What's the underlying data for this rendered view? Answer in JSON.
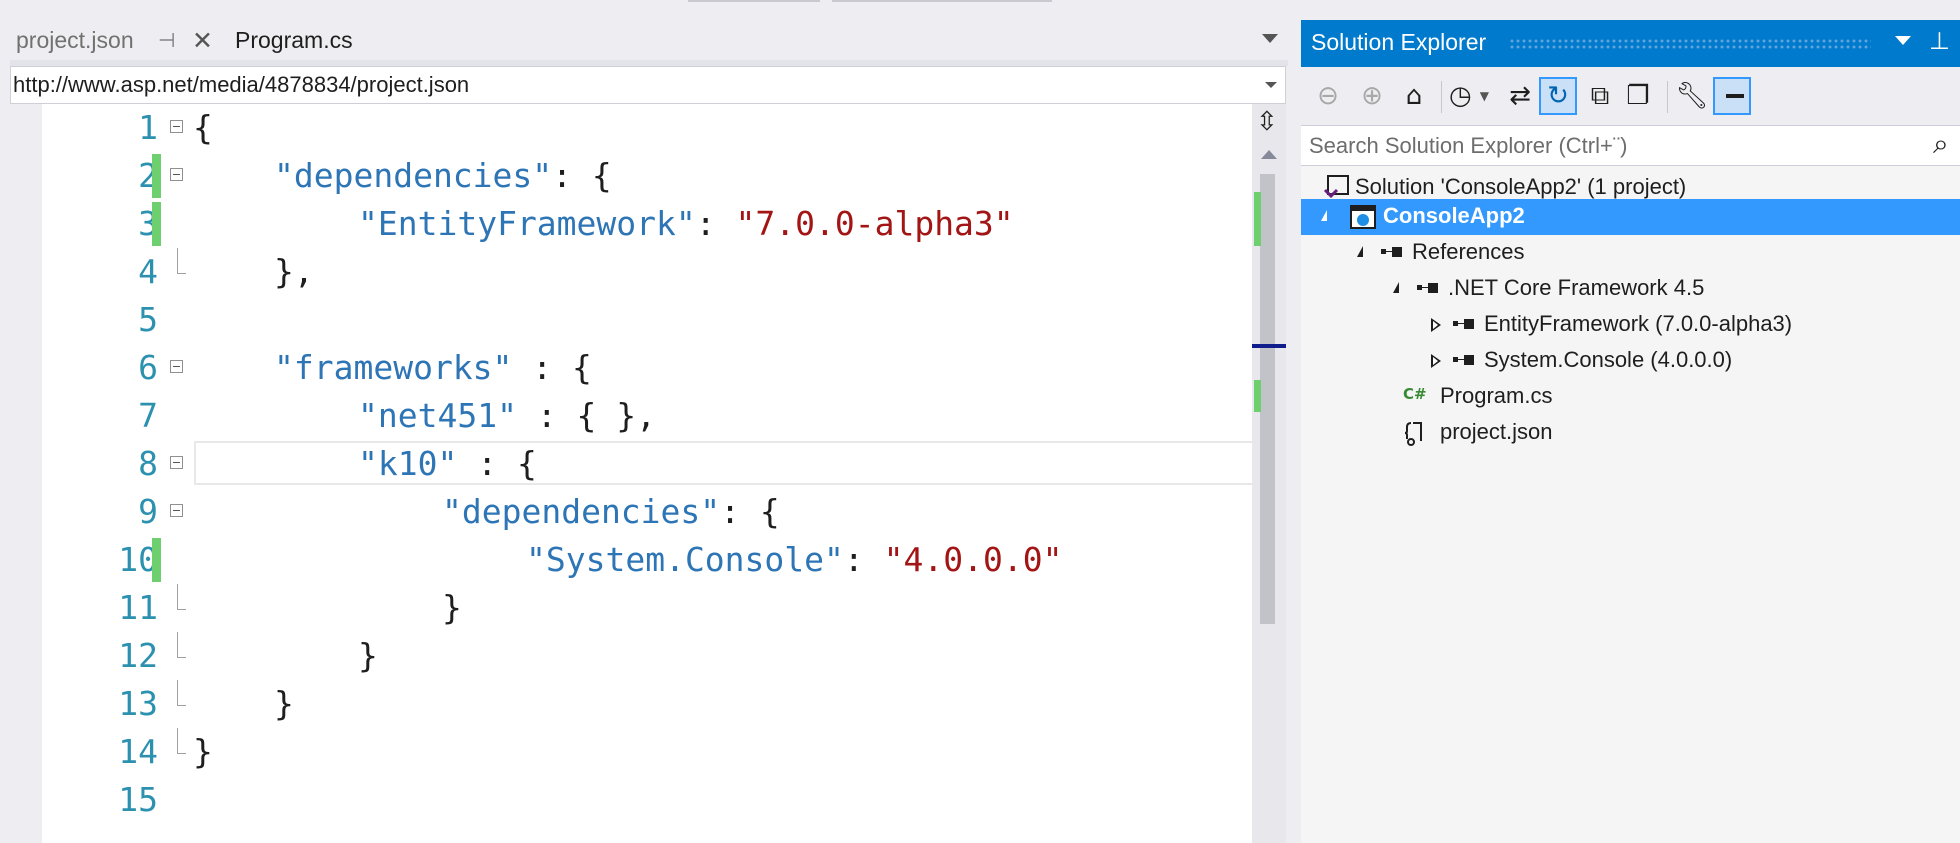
{
  "editor": {
    "tabs": [
      {
        "label": "project.json"
      },
      {
        "label": "Program.cs"
      }
    ],
    "url": "http://www.asp.net/media/4878834/project.json",
    "lines": [
      {
        "num": "1"
      },
      {
        "num": "2"
      },
      {
        "num": "3"
      },
      {
        "num": "4"
      },
      {
        "num": "5"
      },
      {
        "num": "6"
      },
      {
        "num": "7"
      },
      {
        "num": "8"
      },
      {
        "num": "9"
      },
      {
        "num": "10"
      },
      {
        "num": "11"
      },
      {
        "num": "12"
      },
      {
        "num": "13"
      },
      {
        "num": "14"
      },
      {
        "num": "15"
      }
    ],
    "code": {
      "l1": "{",
      "l2_key": "\"dependencies\"",
      "l2_rest": ": {",
      "l3_key": "\"EntityFramework\"",
      "l3_colon": ": ",
      "l3_val": "\"7.0.0-alpha3\"",
      "l4": "},",
      "l6_key": "\"frameworks\"",
      "l6_rest": " : {",
      "l7_key": "\"net451\"",
      "l7_rest": " : { },",
      "l8_key": "\"k10\"",
      "l8_rest": " : {",
      "l9_key": "\"dependencies\"",
      "l9_rest": ": {",
      "l10_key": "\"System.Console\"",
      "l10_colon": ": ",
      "l10_val": "\"4.0.0.0\"",
      "l11": "}",
      "l12": "}",
      "l13": "}",
      "l14": "}"
    }
  },
  "solution_explorer": {
    "title": "Solution Explorer",
    "search_placeholder": "Search Solution Explorer (Ctrl+¨)",
    "tree": {
      "solution": "Solution 'ConsoleApp2' (1 project)",
      "project": "ConsoleApp2",
      "references": "References",
      "framework": ".NET Core Framework 4.5",
      "ref1": "EntityFramework (7.0.0-alpha3)",
      "ref2": "System.Console (4.0.0.0)",
      "file1": "Program.cs",
      "file2": "project.json"
    },
    "toolbar_icons": [
      "back-icon",
      "forward-icon",
      "home-icon",
      "pending-changes-icon",
      "sync-icon",
      "refresh-icon",
      "collapse-all-icon",
      "show-all-files-icon",
      "properties-icon",
      "preview-icon"
    ]
  },
  "colors": {
    "accent": "#007acc",
    "selection": "#3399ff",
    "line_numbers": "#2b91af",
    "json_keys": "#2e75b6",
    "json_strings": "#a31515",
    "change_bar": "#6ecf6e"
  }
}
